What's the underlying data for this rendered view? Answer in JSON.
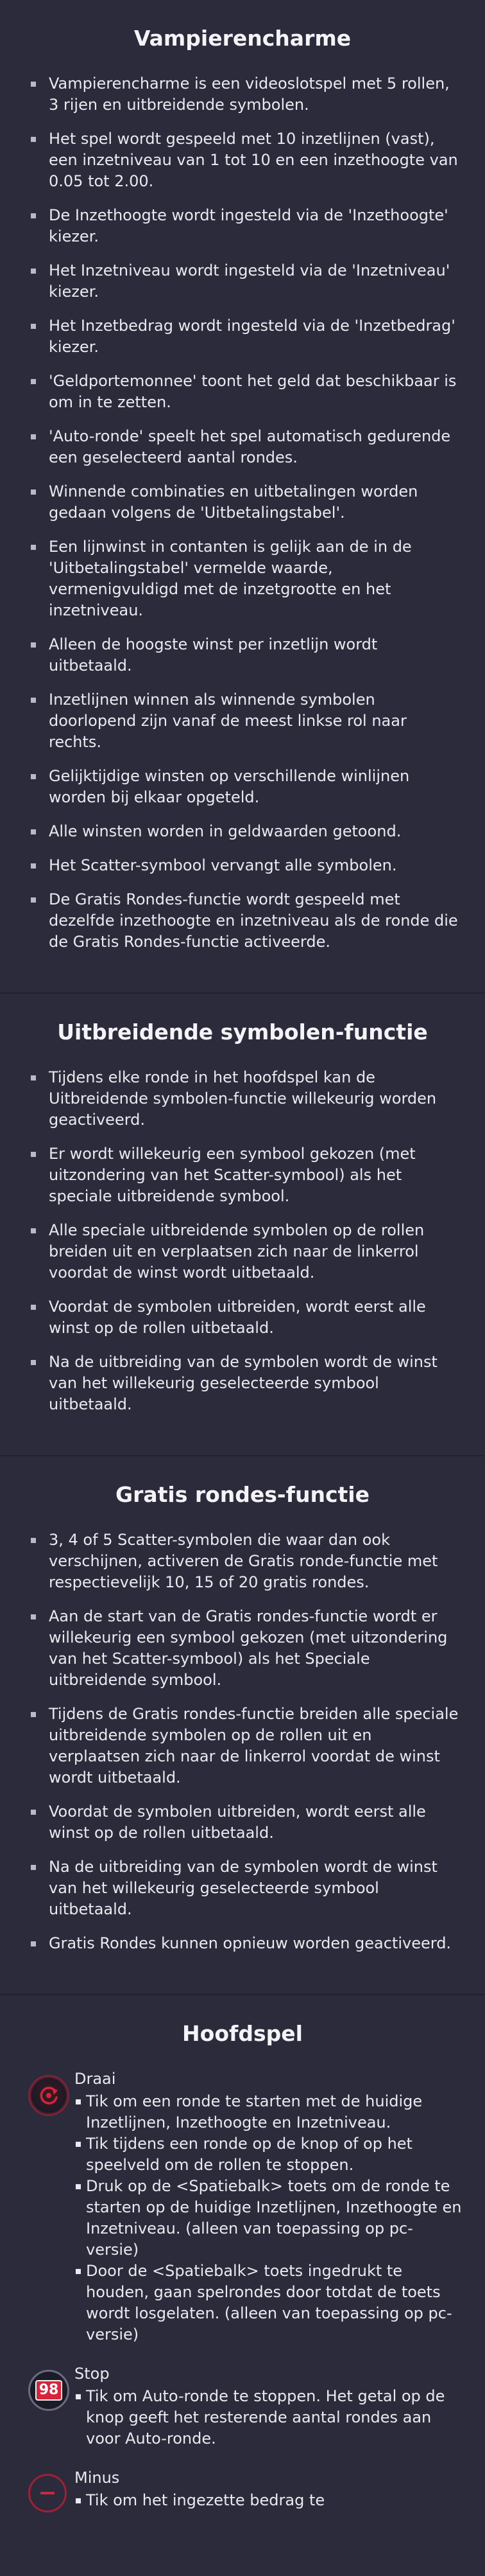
{
  "sections": [
    {
      "title": "Vampierencharme",
      "items": [
        "Vampierencharme is een videoslotspel met 5 rollen, 3 rijen en uitbreidende symbolen.",
        "Het spel wordt gespeeld met 10 inzetlijnen (vast), een inzetniveau van 1 tot 10 en een inzethoogte van 0.05 tot 2.00.",
        "De Inzethoogte wordt ingesteld via de 'Inzethoogte' kiezer.",
        "Het Inzetniveau wordt ingesteld via de 'Inzetniveau' kiezer.",
        "Het Inzetbedrag wordt ingesteld via de 'Inzetbedrag' kiezer.",
        "'Geldportemonnee' toont het geld dat beschikbaar is om in te zetten.",
        "'Auto-ronde' speelt het spel automatisch gedurende een geselecteerd aantal rondes.",
        "Winnende combinaties en uitbetalingen worden gedaan volgens de 'Uitbetalingstabel'.",
        "Een lijnwinst in contanten is gelijk aan de in de 'Uitbetalingstabel' vermelde waarde, vermenigvuldigd met de inzetgrootte en het inzetniveau.",
        "Alleen de hoogste winst per inzetlijn wordt uitbetaald.",
        "Inzetlijnen winnen als winnende symbolen doorlopend zijn vanaf de meest linkse rol naar rechts.",
        "Gelijktijdige winsten op verschillende winlijnen worden bij elkaar opgeteld.",
        "Alle winsten worden in geldwaarden getoond.",
        "Het Scatter-symbool vervangt alle symbolen.",
        "De Gratis Rondes-functie wordt gespeeld met dezelfde inzethoogte en inzetniveau als de ronde die de Gratis Rondes-functie activeerde."
      ]
    },
    {
      "title": "Uitbreidende symbolen-functie",
      "items": [
        "Tijdens elke ronde in het hoofdspel kan de Uitbreidende symbolen-functie willekeurig worden geactiveerd.",
        "Er wordt willekeurig een symbool gekozen (met uitzondering van het Scatter-symbool) als het speciale uitbreidende symbool.",
        "Alle speciale uitbreidende symbolen op de rollen breiden uit en verplaatsen zich naar de linkerrol voordat de winst wordt uitbetaald.",
        "Voordat de symbolen uitbreiden, wordt eerst alle winst op de rollen uitbetaald.",
        "Na de uitbreiding van de symbolen wordt de winst van het willekeurig geselecteerde symbool uitbetaald."
      ]
    },
    {
      "title": "Gratis rondes-functie",
      "items": [
        "3, 4 of 5 Scatter-symbolen die waar dan ook verschijnen, activeren de Gratis ronde-functie met respectievelijk 10, 15 of 20 gratis rondes.",
        "Aan de start van de Gratis rondes-functie wordt er willekeurig een symbool gekozen (met uitzondering van het Scatter-symbool) als het Speciale uitbreidende symbool.",
        "Tijdens de Gratis rondes-functie breiden alle speciale uitbreidende symbolen op de rollen uit en verplaatsen zich naar de linkerrol voordat de winst wordt uitbetaald.",
        "Voordat de symbolen uitbreiden, wordt eerst alle winst op de rollen uitbetaald.",
        "Na de uitbreiding van de symbolen wordt de winst van het willekeurig geselecteerde symbool uitbetaald.",
        "Gratis Rondes kunnen opnieuw worden geactiveerd."
      ]
    }
  ],
  "hoofdspel": {
    "title": "Hoofdspel",
    "controls": [
      {
        "icon": "spin-icon",
        "name": "Draai",
        "items": [
          "Tik om een ronde te starten met de huidige Inzetlijnen, Inzethoogte en Inzetniveau.",
          "Tik tijdens een ronde op de knop of op het speelveld om de rollen te stoppen.",
          "Druk op de <Spatiebalk> toets om de ronde te starten op de huidige Inzetlijnen, Inzethoogte en Inzetniveau. (alleen van toepassing op pc-versie)",
          "Door de <Spatiebalk> toets ingedrukt te houden, gaan spelrondes door totdat de toets wordt losgelaten. (alleen van toepassing op pc-versie)"
        ]
      },
      {
        "icon": "stop-icon",
        "icon_number": "98",
        "name": "Stop",
        "items": [
          "Tik om Auto-ronde te stoppen. Het getal op de knop geeft het resterende aantal rondes aan voor Auto-ronde."
        ]
      },
      {
        "icon": "minus-icon",
        "name": "Minus",
        "items": [
          "Tik om het ingezette bedrag te"
        ]
      }
    ]
  },
  "colors": {
    "background": "#2b2b3b",
    "text": "#e9e9ef",
    "accent_red": "#d8243a"
  }
}
